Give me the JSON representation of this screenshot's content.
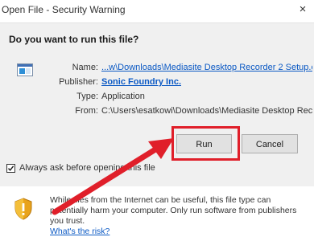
{
  "window": {
    "title": "Open File - Security Warning",
    "close_glyph": "×"
  },
  "dialog": {
    "question": "Do you want to run this file?",
    "fields": [
      {
        "label": "Name:",
        "value": "...w\\Downloads\\Mediasite Desktop Recorder 2 Setup.exe"
      },
      {
        "label": "Publisher:",
        "value": "Sonic Foundry Inc."
      },
      {
        "label": "Type:",
        "value": "Application"
      },
      {
        "label": "From:",
        "value": "C:\\Users\\esatkowi\\Downloads\\Mediasite Desktop Reco..."
      }
    ],
    "run_label": "Run",
    "cancel_label": "Cancel",
    "checkbox": {
      "label": "Always ask before opening this file",
      "checked": true
    }
  },
  "warning": {
    "text": "While files from the Internet can be useful, this file type can potentially harm your computer. Only run software from publishers you trust.",
    "link": "What's the risk?"
  },
  "annotation": {
    "highlight_color": "#e01f2a",
    "arrow_color": "#e01f2a"
  },
  "colors": {
    "link": "#0b59c4",
    "panel_bg": "#f0f0f0",
    "button_bg": "#e1e1e1"
  },
  "icons": {
    "app": "application-icon",
    "shield": "security-shield-icon",
    "close": "close-icon"
  }
}
